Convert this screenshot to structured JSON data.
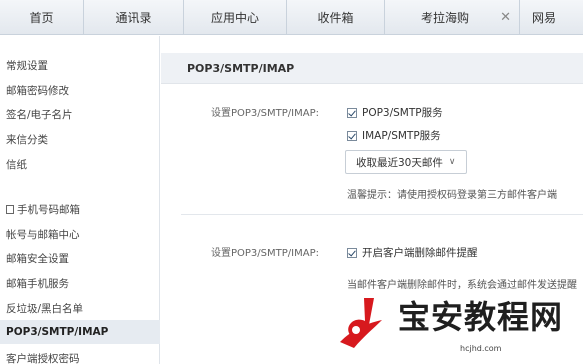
{
  "tabs": [
    {
      "label": "首页"
    },
    {
      "label": "通讯录"
    },
    {
      "label": "应用中心"
    },
    {
      "label": "收件箱"
    },
    {
      "label": "考拉海购"
    },
    {
      "label": "网易"
    }
  ],
  "sidebar": {
    "items": [
      {
        "label": "常规设置"
      },
      {
        "label": "邮箱密码修改"
      },
      {
        "label": "签名/电子名片"
      },
      {
        "label": "来信分类"
      },
      {
        "label": "信纸"
      },
      {
        "label": "手机号码邮箱"
      },
      {
        "label": "帐号与邮箱中心"
      },
      {
        "label": "邮箱安全设置"
      },
      {
        "label": "邮箱手机服务"
      },
      {
        "label": "反垃圾/黑白名单"
      },
      {
        "label": "POP3/SMTP/IMAP"
      },
      {
        "label": "客户端授权密码"
      }
    ]
  },
  "panel": {
    "title": "POP3/SMTP/IMAP",
    "row1_label": "设置POP3/SMTP/IMAP:",
    "opt_pop3": "POP3/SMTP服务",
    "opt_imap": "IMAP/SMTP服务",
    "select_value": "收取最近30天邮件",
    "hint": "温馨提示：请使用授权码登录第三方邮件客户端",
    "row2_label": "设置POP3/SMTP/IMAP:",
    "opt_delete": "开启客户端删除邮件提醒",
    "delete_hint": "当邮件客户端删除邮件时，系统会通过邮件发送提醒"
  },
  "watermark": {
    "text": "宝安教程网",
    "url": "hcjhd.com"
  },
  "colors": {
    "logo_red": "#d7191e",
    "active_bg": "#e6ebf1"
  }
}
